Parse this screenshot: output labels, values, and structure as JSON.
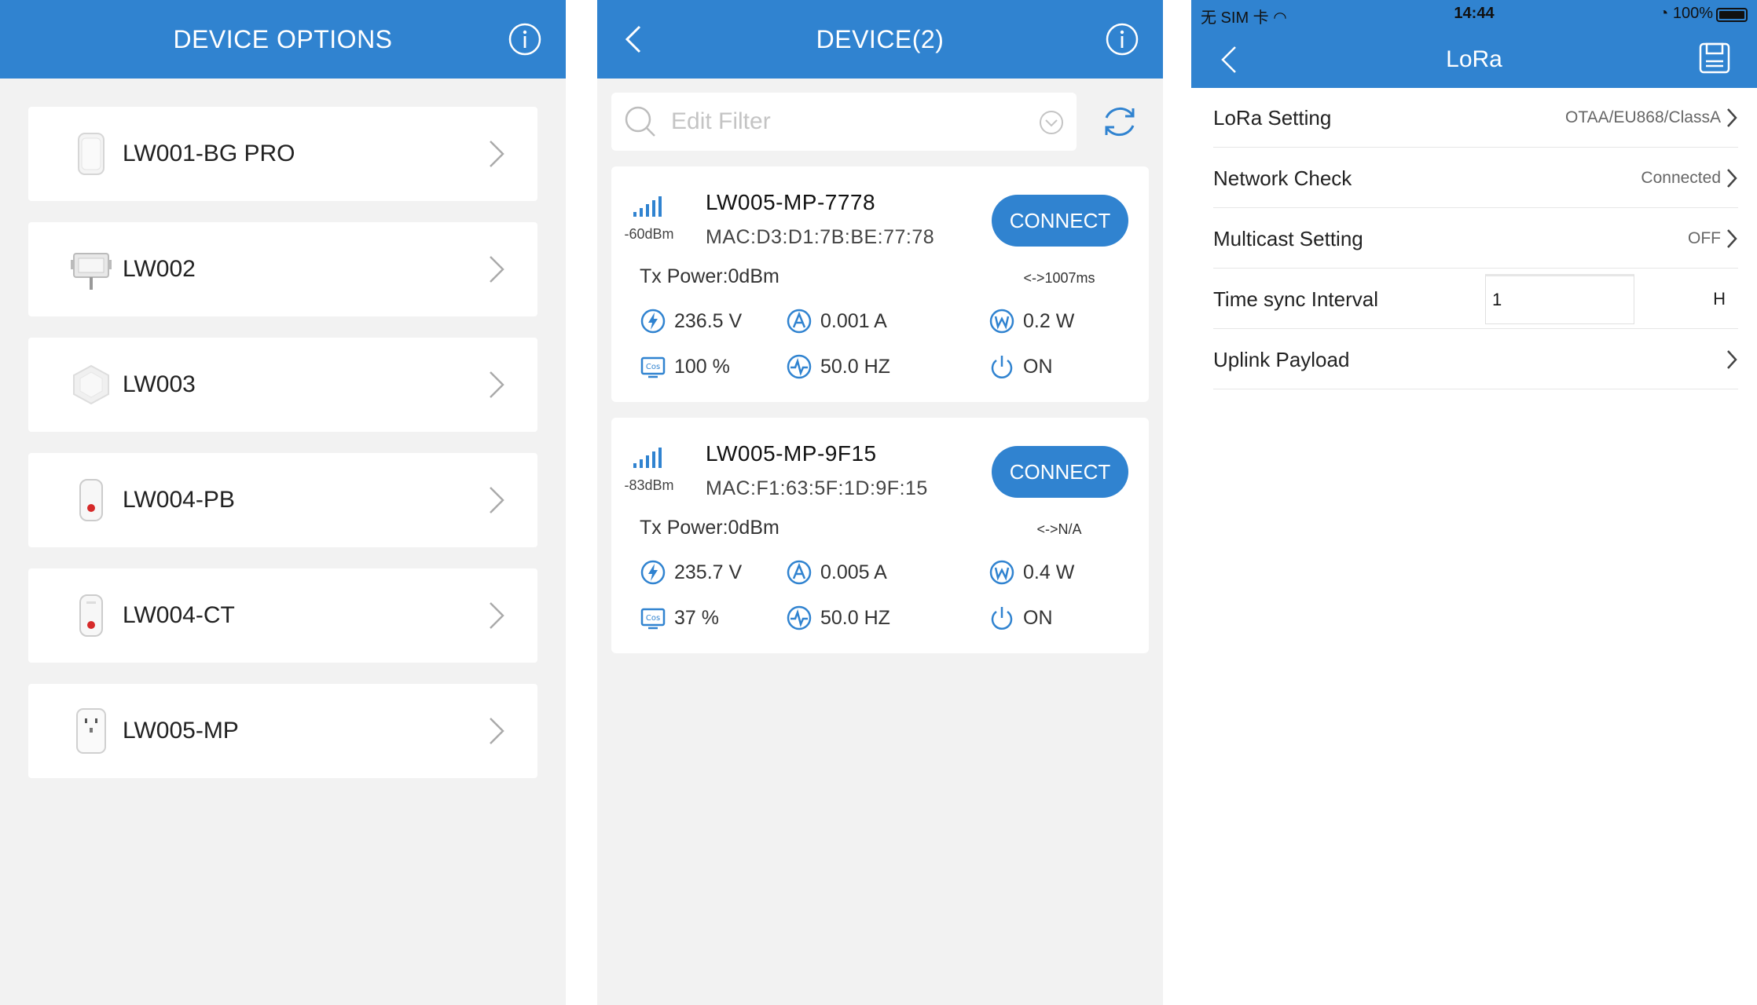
{
  "panel1": {
    "title": "DEVICE OPTIONS",
    "devices": [
      {
        "label": "LW001-BG PRO"
      },
      {
        "label": "LW002"
      },
      {
        "label": "LW003"
      },
      {
        "label": "LW004-PB"
      },
      {
        "label": "LW004-CT"
      },
      {
        "label": "LW005-MP"
      }
    ]
  },
  "panel2": {
    "title": "DEVICE(2)",
    "search": {
      "placeholder": "Edit Filter"
    },
    "devices": [
      {
        "rssi": "-60dBm",
        "name": "LW005-MP-7778",
        "mac": "MAC:D3:D1:7B:BE:77:78",
        "connect_label": "CONNECT",
        "tx_power": "Tx Power:0dBm",
        "interval": "<->1007ms",
        "voltage": "236.5 V",
        "current": "0.001 A",
        "power": "0.2 W",
        "power_factor": "100 %",
        "frequency": "50.0 HZ",
        "state": "ON"
      },
      {
        "rssi": "-83dBm",
        "name": "LW005-MP-9F15",
        "mac": "MAC:F1:63:5F:1D:9F:15",
        "connect_label": "CONNECT",
        "tx_power": "Tx Power:0dBm",
        "interval": "<->N/A",
        "voltage": "235.7 V",
        "current": "0.005 A",
        "power": "0.4 W",
        "power_factor": "37 %",
        "frequency": "50.0 HZ",
        "state": "ON"
      }
    ]
  },
  "panel3": {
    "status": {
      "carrier": "无 SIM 卡",
      "time": "14:44",
      "battery": "100%"
    },
    "title": "LoRa",
    "rows": {
      "lora_setting": {
        "label": "LoRa Setting",
        "value": "OTAA/EU868/ClassA"
      },
      "network_check": {
        "label": "Network Check",
        "value": "Connected"
      },
      "multicast": {
        "label": "Multicast Setting",
        "value": "OFF"
      },
      "time_sync": {
        "label": "Time sync Interval",
        "value": "1",
        "unit": "H"
      },
      "uplink": {
        "label": "Uplink Payload"
      }
    }
  },
  "colors": {
    "primary": "#3083d0",
    "background": "#f2f2f2",
    "card": "#ffffff"
  }
}
